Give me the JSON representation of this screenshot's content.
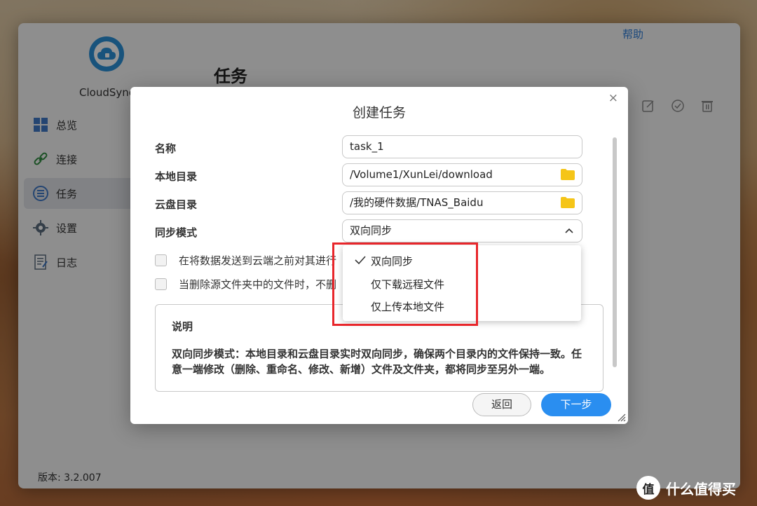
{
  "app": {
    "help_label": "帮助",
    "name": "CloudSync",
    "version": "版本: 3.2.007",
    "page_title": "任务"
  },
  "sidebar": {
    "items": [
      {
        "label": "总览",
        "icon": "overview-icon"
      },
      {
        "label": "连接",
        "icon": "link-icon"
      },
      {
        "label": "任务",
        "icon": "task-icon",
        "active": true
      },
      {
        "label": "设置",
        "icon": "gear-icon"
      },
      {
        "label": "日志",
        "icon": "log-icon"
      }
    ]
  },
  "toolbar": {
    "icons": [
      "edit-icon",
      "check-circle-icon",
      "trash-icon"
    ]
  },
  "dialog": {
    "title": "创建任务",
    "close": "×",
    "name_label": "名称",
    "name_value": "task_1",
    "local_dir_label": "本地目录",
    "local_dir_value": "/Volume1/XunLei/download",
    "cloud_dir_label": "云盘目录",
    "cloud_dir_value": "/我的硬件数据/TNAS_Baidu",
    "sync_mode_label": "同步模式",
    "sync_mode_value": "双向同步",
    "checkbox1_label": "在将数据发送到云端之前对其进行",
    "checkbox2_label": "当删除源文件夹中的文件时，不删",
    "desc_title": "说明",
    "desc_text": "双向同步模式：本地目录和云盘目录实时双向同步，确保两个目录内的文件保持一致。任意一端修改（删除、重命名、修改、新增）文件及文件夹，都将同步至另外一端。",
    "back_label": "返回",
    "next_label": "下一步"
  },
  "dropdown": {
    "options": [
      "双向同步",
      "仅下载远程文件",
      "仅上传本地文件"
    ],
    "selected": "双向同步"
  },
  "watermark": {
    "logo_char": "值",
    "text": "什么值得买"
  },
  "colors": {
    "accent": "#2a8ef0",
    "highlight": "#e8262b",
    "folder": "#f5c518"
  }
}
